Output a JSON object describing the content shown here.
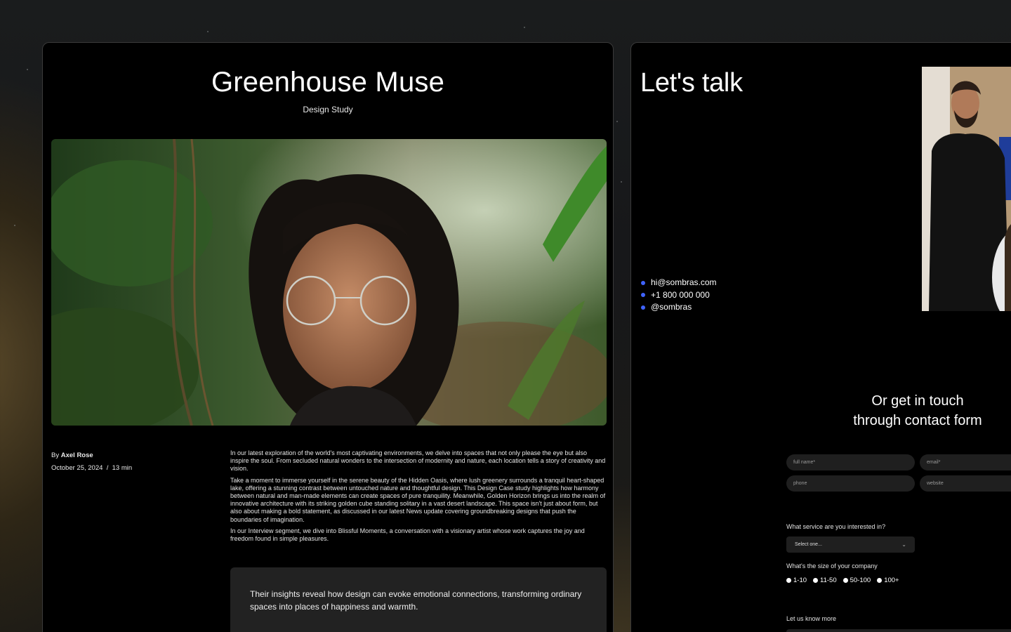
{
  "article": {
    "title": "Greenhouse Muse",
    "subtitle": "Design Study",
    "author_prefix": "By",
    "author": "Axel Rose",
    "date": "October 25, 2024",
    "separator": "/",
    "read_time": "13 min",
    "paragraphs": [
      "In our latest exploration of the world's most captivating environments, we delve into spaces that not only please the eye but also inspire the soul. From secluded natural wonders to the intersection of modernity and nature, each location tells a story of creativity and vision.",
      "Take a moment to immerse yourself in the serene beauty of the Hidden Oasis, where lush greenery surrounds a tranquil heart-shaped lake, offering a stunning contrast between untouched nature and thoughtful design. This Design Case study highlights how harmony between natural and man-made elements can create spaces of pure tranquility. Meanwhile, Golden Horizon brings us into the realm of innovative architecture with its striking golden cube standing solitary in a vast desert landscape. This space isn't just about form, but also about making a bold statement, as discussed in our latest News update covering groundbreaking designs that push the boundaries of imagination.",
      "In our Interview segment, we dive into Blissful Moments, a conversation with a visionary artist whose work captures the joy and freedom found in simple pleasures."
    ],
    "quote": "Their insights reveal how design can evoke emotional connections, transforming ordinary spaces into places of happiness and warmth."
  },
  "contact": {
    "title": "Let's talk",
    "email": "hi@sombras.com",
    "phone": "+1 800 000 000",
    "handle": "@sombras",
    "form_heading_line1": "Or get in touch",
    "form_heading_line2": "through contact form",
    "placeholders": {
      "full_name": "full name*",
      "email": "email*",
      "phone": "phone",
      "website": "website"
    },
    "service_label": "What service are you interested in?",
    "service_selected": "Select one...",
    "size_label": "What's the size of your company",
    "size_options": [
      "1-10",
      "11-50",
      "50-100",
      "100+"
    ],
    "more_label": "Let us know more"
  },
  "colors": {
    "accent_dot": "#3f63ff",
    "card_bg": "#000000",
    "field_bg": "#1f1f1f"
  }
}
